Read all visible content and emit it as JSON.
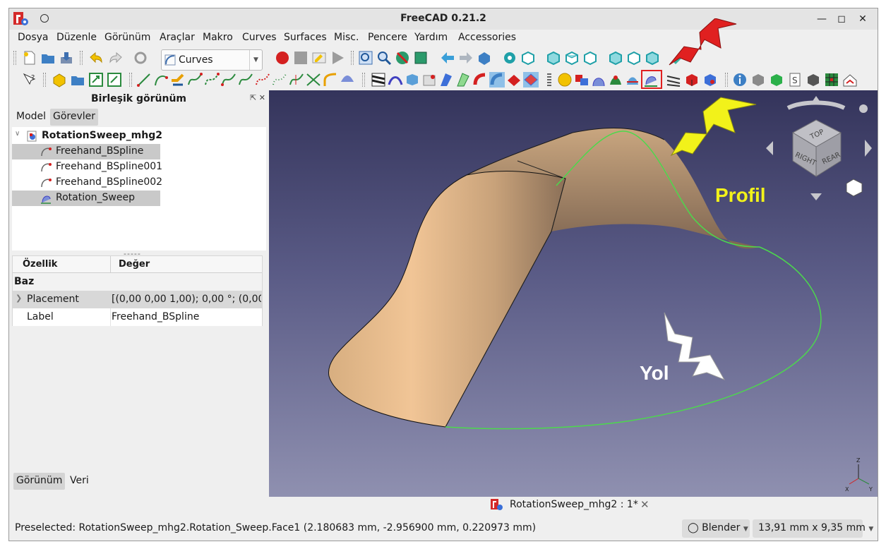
{
  "window": {
    "title": "FreeCAD 0.21.2"
  },
  "menu": [
    "Dosya",
    "Düzenle",
    "Görünüm",
    "Araçlar",
    "Makro",
    "Curves",
    "Surfaces",
    "Misc.",
    "Pencere",
    "Yardım",
    "Accessories"
  ],
  "toolbar": {
    "workbench_value": "Curves"
  },
  "combo_view": {
    "title": "Birleşik görünüm",
    "tabs": [
      "Model",
      "Görevler"
    ],
    "active_tab": "Görevler",
    "tree": [
      {
        "label": "RotationSweep_mhg2",
        "level": 0,
        "selected": false,
        "bold": true
      },
      {
        "label": "Freehand_BSpline",
        "level": 1,
        "selected": true
      },
      {
        "label": "Freehand_BSpline001",
        "level": 1,
        "selected": false
      },
      {
        "label": "Freehand_BSpline002",
        "level": 1,
        "selected": false
      },
      {
        "label": "Rotation_Sweep",
        "level": 1,
        "selected": true
      }
    ],
    "splitter": "-----",
    "property_header": {
      "col1": "Özellik",
      "col2": "Değer"
    },
    "property_group": "Baz",
    "properties": [
      {
        "name": "Placement",
        "value": "[(0,00 0,00 1,00); 0,00 °; (0,00 ..."
      },
      {
        "name": "Label",
        "value": "Freehand_BSpline"
      }
    ],
    "bottom_tabs": [
      "Görünüm",
      "Veri"
    ]
  },
  "viewport": {
    "annotation_profile": "Profil",
    "annotation_path": "Yol",
    "navcube_faces": [
      "TOP",
      "RIGHT",
      "REAR"
    ],
    "axis_labels": [
      "Z",
      "Y",
      "X"
    ],
    "colors": {
      "surface": "#e4bd92",
      "curve": "#4cd94c",
      "profile_text": "#f2f21a",
      "path_text": "#ffffff",
      "highlight_box": "#e02020"
    }
  },
  "doc_tab": {
    "label": "RotationSweep_mhg2 : 1*"
  },
  "status": {
    "text": "Preselected: RotationSweep_mhg2.Rotation_Sweep.Face1 (2.180683 mm, -2.956900 mm, 0.220973 mm)",
    "nav_style": "Blender",
    "dimensions": "13,91 mm x 9,35 mm"
  }
}
